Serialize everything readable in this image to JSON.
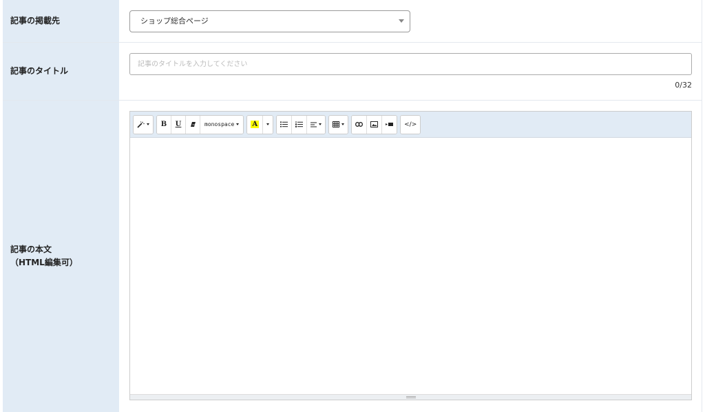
{
  "rows": {
    "placement": {
      "label": "記事の掲載先",
      "selected": "ショップ総合ページ"
    },
    "title": {
      "label": "記事のタイトル",
      "placeholder": "記事のタイトルを入力してください",
      "value": "",
      "counter": "0/32"
    },
    "body": {
      "label_line1": "記事の本文",
      "label_line2": "（HTML編集可）"
    }
  },
  "toolbar": {
    "style_icon": "magic-wand-icon",
    "bold": "B",
    "underline": "U",
    "eraser_icon": "eraser-icon",
    "font_name": "monospace",
    "color_letter": "A",
    "ul_icon": "unordered-list-icon",
    "ol_icon": "ordered-list-icon",
    "align_icon": "align-icon",
    "table_icon": "table-icon",
    "link_icon": "link-icon",
    "image_icon": "image-icon",
    "video_icon": "video-icon",
    "code_view": "</>"
  },
  "colors": {
    "label_bg": "#e1ebf5",
    "highlight": "#ffff00"
  }
}
